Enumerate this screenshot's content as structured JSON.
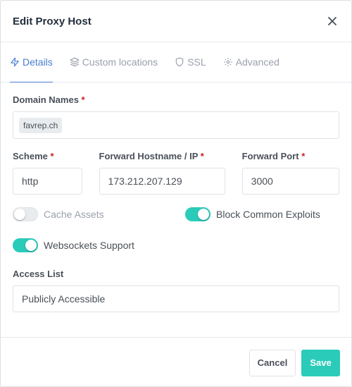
{
  "modal": {
    "title": "Edit Proxy Host",
    "close_label": "×"
  },
  "tabs": [
    {
      "label": "Details",
      "icon": "bolt-icon",
      "active": true
    },
    {
      "label": "Custom locations",
      "icon": "layers-icon",
      "active": false
    },
    {
      "label": "SSL",
      "icon": "shield-icon",
      "active": false
    },
    {
      "label": "Advanced",
      "icon": "gear-icon",
      "active": false
    }
  ],
  "domain_names": {
    "label": "Domain Names",
    "required_mark": "*",
    "values": [
      "favrep.ch"
    ]
  },
  "scheme": {
    "label": "Scheme",
    "required_mark": "*",
    "value": "http"
  },
  "forward_host": {
    "label": "Forward Hostname / IP",
    "required_mark": "*",
    "value": "173.212.207.129"
  },
  "forward_port": {
    "label": "Forward Port",
    "required_mark": "*",
    "value": "3000"
  },
  "toggles": {
    "cache_assets": {
      "label": "Cache Assets",
      "on": false
    },
    "block_exploits": {
      "label": "Block Common Exploits",
      "on": true
    },
    "websockets": {
      "label": "Websockets Support",
      "on": true
    }
  },
  "access_list": {
    "label": "Access List",
    "value": "Publicly Accessible"
  },
  "footer": {
    "cancel_label": "Cancel",
    "save_label": "Save"
  },
  "colors": {
    "accent": "#467fcf",
    "teal": "#2bcbba",
    "required": "#cd201f"
  }
}
